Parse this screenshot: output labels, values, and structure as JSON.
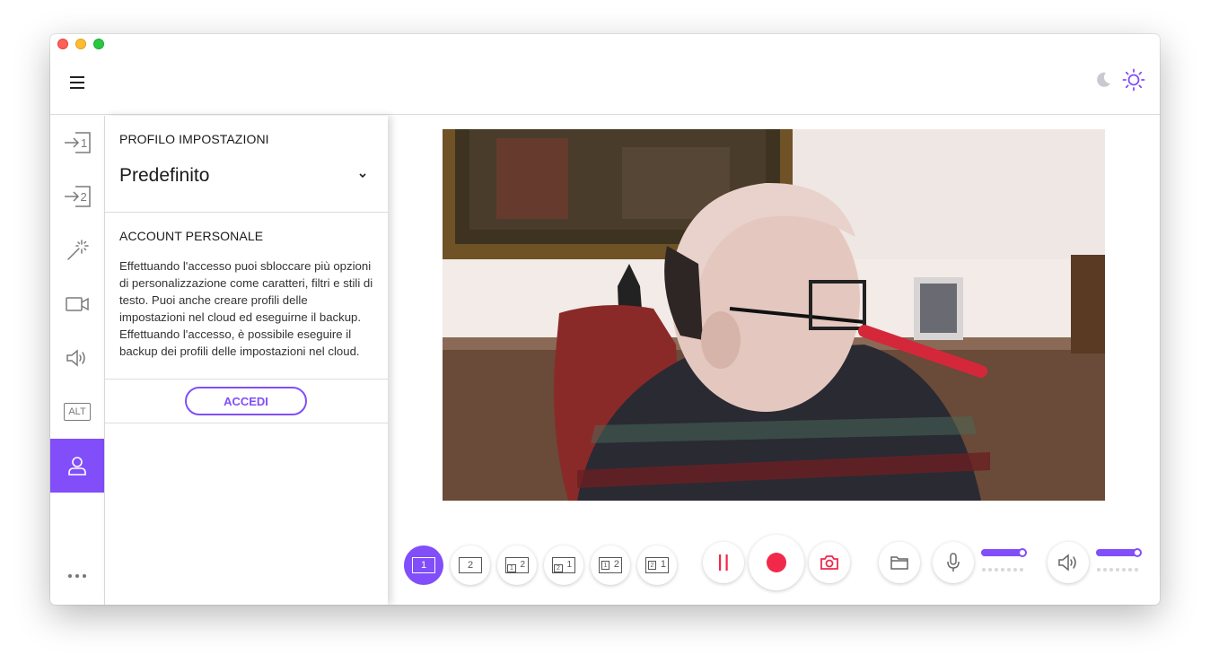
{
  "icons": {
    "menu": "hamburger-menu-icon",
    "moon": "moon-icon",
    "sun": "sun-icon",
    "source1": "input-1-icon",
    "source2": "input-2-icon",
    "effects": "magic-wand-icon",
    "camera": "video-camera-icon",
    "audio": "speaker-icon",
    "alt": "alt-badge-icon",
    "account": "user-icon",
    "more": "more-dots-icon",
    "pause": "pause-icon",
    "record": "record-icon",
    "snapshot": "camera-icon",
    "folder": "folder-icon",
    "mic": "microphone-icon",
    "speaker": "speaker-icon"
  },
  "colors": {
    "accent": "#814efa",
    "record": "#f2284a"
  },
  "sidebar": {
    "alt_label": "ALT"
  },
  "panel": {
    "profile_title": "PROFILO IMPOSTAZIONI",
    "profile_value": "Predefinito",
    "account_title": "ACCOUNT PERSONALE",
    "account_desc": "Effettuando l'accesso puoi sbloccare più opzioni di personalizzazione come caratteri, filtri e stili di testo. Puoi anche creare profili delle impostazioni nel cloud ed eseguirne il backup. Effettuando l'accesso, è possibile eseguire il backup dei profili delle impostazioni nel cloud.",
    "login_button": "ACCEDI"
  },
  "layouts": {
    "single_1": "1",
    "single_2": "2",
    "pip_a": [
      "1",
      "2"
    ],
    "pip_b": [
      "2",
      "1"
    ],
    "split_a": [
      "1",
      "2"
    ],
    "split_b": [
      "2",
      "1"
    ]
  },
  "audio": {
    "mic_level": 0.92,
    "speaker_level": 0.92
  }
}
